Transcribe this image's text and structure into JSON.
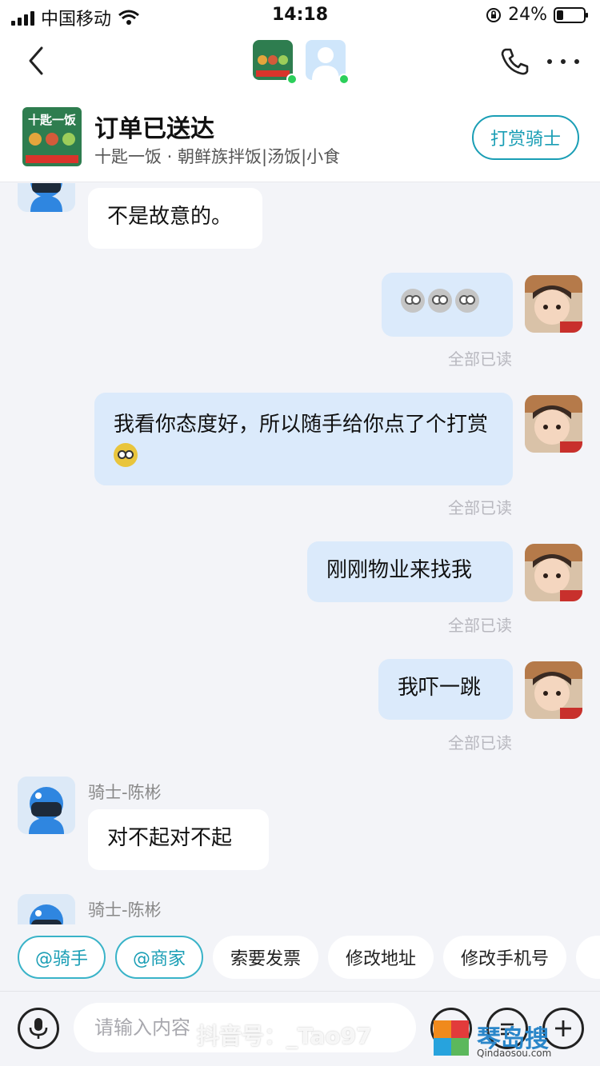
{
  "status_bar": {
    "carrier": "中国移动",
    "time": "14:18",
    "battery": "24%"
  },
  "header": {
    "order_status": "订单已送达",
    "shop_line": "十匙一饭 · 朝鲜族拌饭|汤饭|小食",
    "tip_button": "打赏骑士",
    "shop_logo_text": "十匙一饭"
  },
  "messages": [
    {
      "side": "left",
      "text": "不是故意的。"
    },
    {
      "side": "right",
      "text": "",
      "read": "全部已读"
    },
    {
      "side": "right",
      "text": "我看你态度好，所以随手给你点了个打赏",
      "read": "全部已读"
    },
    {
      "side": "right",
      "text": "刚刚物业来找我",
      "read": "全部已读"
    },
    {
      "side": "right",
      "text": "我吓一跳",
      "read": "全部已读"
    },
    {
      "side": "left",
      "sender": "骑士-陈彬",
      "text": "对不起对不起"
    },
    {
      "side": "left",
      "sender": "骑士-陈彬",
      "text": ""
    }
  ],
  "quick_actions": [
    "@骑手",
    "@商家",
    "索要发票",
    "修改地址",
    "修改手机号"
  ],
  "input": {
    "placeholder": "请输入内容"
  },
  "watermark": "抖音号：_Tao97",
  "brand": {
    "name": "琴岛搜",
    "url": "Qindaosou.com"
  },
  "colors": {
    "accent": "#1a9eb5",
    "bubble_right": "#dbeafb",
    "online": "#2bcf5a"
  }
}
